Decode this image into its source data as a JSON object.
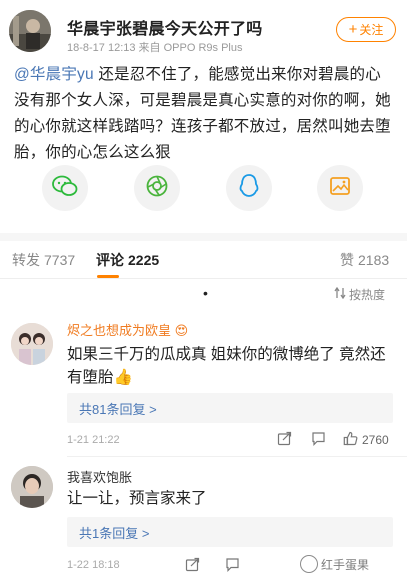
{
  "post": {
    "title": "华晨宇张碧晨今天公开了吗",
    "meta": "18-8-17 12:13  来自 OPPO R9s Plus",
    "follow_label": "关注",
    "follow_plus": "+",
    "mention": "@华晨宇yu",
    "body": "还是忍不住了，能感觉出来你对碧晨的心没有那个女人深，可是碧晨是真心实意的对你的啊，她的心你就这样践踏吗？连孩子都不放过，居然叫她去堕胎，你的心怎么这么狠"
  },
  "share": {
    "icons": [
      "wechat-icon",
      "moments-icon",
      "qq-icon",
      "album-icon"
    ],
    "colors": {
      "wechat": "#2dba3c",
      "moments": "#4ab43c",
      "qq": "#1a9ae6",
      "album": "#f4a022"
    }
  },
  "stats": {
    "repost_label": "转发",
    "repost_count": "7737",
    "comment_label": "评论",
    "comment_count": "2225",
    "like_label": "赞",
    "like_count": "2183",
    "sort_label": "按热度"
  },
  "comments": [
    {
      "name": "烬之也想成为欧皇",
      "badge": "😍",
      "text": "如果三千万的瓜成真 姐妹你的微博绝了 竟然还有堕胎👍",
      "replies": "共81条回复 >",
      "time": "1-21 21:22",
      "likes": "2760"
    },
    {
      "name": "我喜欢饱胀",
      "text": "让一让，预言家来了",
      "replies": "共1条回复 >",
      "time": "1-22 18:18",
      "likes": ""
    }
  ],
  "watermark": "红手蛋果",
  "colors": {
    "accent": "#ff8200",
    "link": "#4a77b5",
    "name_orange": "#f07c22"
  }
}
